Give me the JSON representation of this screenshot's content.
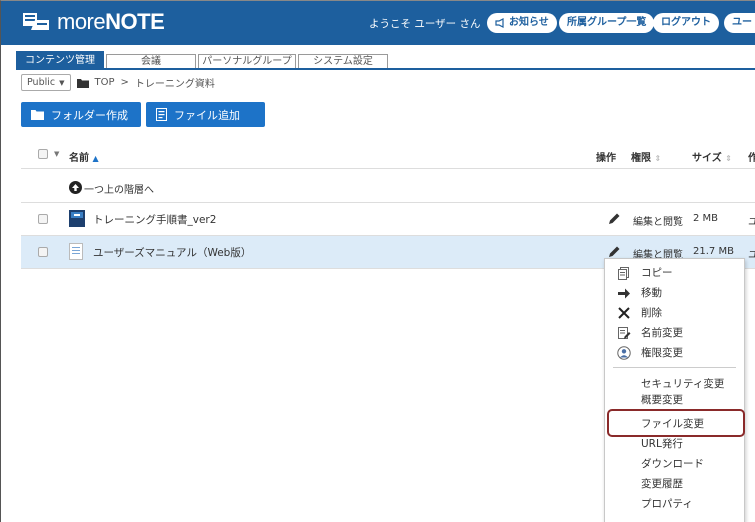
{
  "header": {
    "logo_prefix": "more",
    "logo_main": "NOTE",
    "welcome": "ようこそ ユーザー さん",
    "buttons": {
      "news": "お知らせ",
      "groups": "所属グループ一覧",
      "logout": "ログアウト",
      "user_cut": "ユー"
    }
  },
  "tabs": [
    "コンテンツ管理",
    "会議",
    "パーソナルグループ",
    "システム設定"
  ],
  "breadcrumb": {
    "scope": "Public",
    "top": "TOP",
    "separator": ">",
    "folder": "トレーニング資料"
  },
  "actions": {
    "new_folder": "フォルダー作成",
    "add_file": "ファイル追加"
  },
  "table": {
    "columns": {
      "name": "名前",
      "ops": "操作",
      "perm": "権限",
      "size": "サイズ",
      "author_cut": "作"
    },
    "up_row": "一つ上の階層へ",
    "rows": [
      {
        "name": "トレーニング手順書_ver2",
        "perm": "編集と閲覧",
        "size": "2 MB",
        "author_cut": "ユ"
      },
      {
        "name": "ユーザーズマニュアル（Web版）",
        "perm": "編集と閲覧",
        "size": "21.7 MB",
        "author_cut": "ユ"
      }
    ]
  },
  "context_menu": {
    "items_icon": [
      {
        "label": "コピー",
        "icon": "copy-icon"
      },
      {
        "label": "移動",
        "icon": "move-arrow-icon"
      },
      {
        "label": "削除",
        "icon": "delete-x-icon"
      },
      {
        "label": "名前変更",
        "icon": "rename-icon"
      },
      {
        "label": "権限変更",
        "icon": "permission-icon"
      }
    ],
    "items_text": [
      "セキュリティ変更",
      "概要変更",
      "ファイル変更",
      "URL発行",
      "ダウンロード",
      "変更履歴",
      "プロパティ"
    ]
  },
  "colors": {
    "brand": "#1d5f9e",
    "button": "#1d73c8",
    "row_highlight": "#dcebf8",
    "focus_outline": "#8a2a2a"
  }
}
